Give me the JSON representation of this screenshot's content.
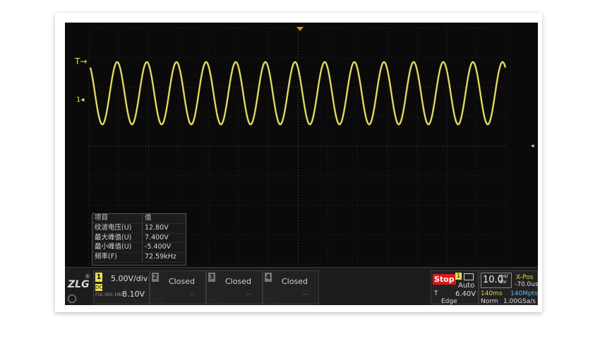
{
  "waveform": {
    "color": "#d8d038",
    "cycles": 14,
    "amplitude_frac": 0.92
  },
  "markers": {
    "trigger": "T",
    "channel1": "1",
    "trigger_arrow_color": "#e08a1a"
  },
  "measurements": {
    "headers": [
      "项目",
      "值"
    ],
    "rows": [
      {
        "name": "纹波电压(U)",
        "value": "12.80V"
      },
      {
        "name": "最大峰值(U)",
        "value": "7.400V"
      },
      {
        "name": "最小峰值(U)",
        "value": "-5.400V"
      },
      {
        "name": "频率(F)",
        "value": "72.59kHz"
      }
    ]
  },
  "channels": {
    "ch1": {
      "num": "1",
      "volts_div": "5.00V/div",
      "offset": "8.10V",
      "color": "#e8e050",
      "coupling": "DC",
      "bw": "FUL 500 1MΩ"
    },
    "ch2": {
      "num": "2",
      "status": "Closed",
      "value": "--",
      "sub": "- . -"
    },
    "ch3": {
      "num": "3",
      "status": "Closed",
      "value": "--",
      "sub": "- . -"
    },
    "ch4": {
      "num": "4",
      "status": "Closed",
      "value": "--",
      "sub": "- . -"
    }
  },
  "trigger": {
    "state": "Stop",
    "source": "1",
    "mode": "Auto",
    "label": "T",
    "level": "6.40V",
    "type": "Edge"
  },
  "timebase": {
    "value": "10.0",
    "unit_top": "ms/",
    "unit_bottom": "div",
    "xpos_label": "X-Pos",
    "xpos_value": "-70.0us",
    "length": "140ms",
    "points": "140Mpts",
    "acq_mode": "Norm",
    "rate": "1.00GSa/s"
  },
  "logo": {
    "text": "ZLG",
    "reg": "®"
  }
}
